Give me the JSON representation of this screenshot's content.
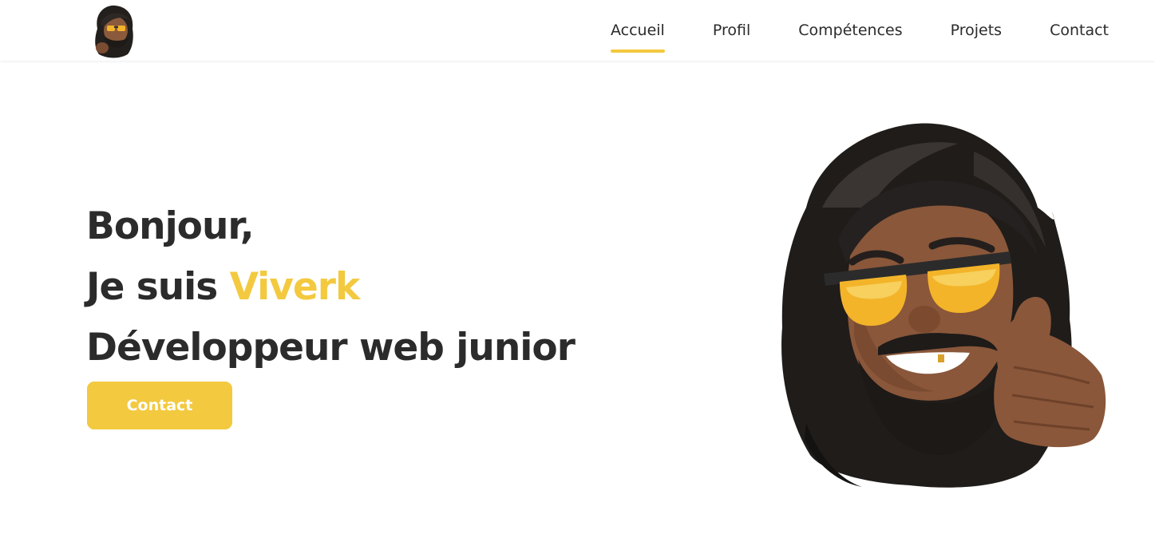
{
  "header": {
    "logo_icon": "memoji-avatar-icon",
    "nav": [
      {
        "label": "Accueil",
        "active": true
      },
      {
        "label": "Profil",
        "active": false
      },
      {
        "label": "Compétences",
        "active": false
      },
      {
        "label": "Projets",
        "active": false
      },
      {
        "label": "Contact",
        "active": false
      }
    ]
  },
  "hero": {
    "greeting": "Bonjour,",
    "intro_prefix": "Je suis ",
    "name": "Viverk",
    "role": "Développeur web junior",
    "contact_button": "Contact",
    "illustration_icon": "memoji-thumbs-up-icon"
  },
  "colors": {
    "accent": "#f3c940",
    "text": "#2b2b2b",
    "background": "#ffffff"
  }
}
